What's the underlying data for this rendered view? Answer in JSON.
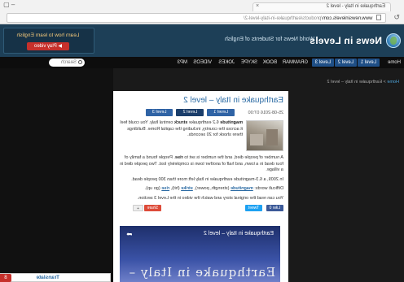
{
  "browser": {
    "tab_title": "Earthquake in Italy - level 2",
    "url_domain": "www.newsinlevels.com",
    "url_path": "/products/earthquake-in-italy-level-2/"
  },
  "header": {
    "logo": "News in Levels",
    "tagline": "World News for Students of English",
    "promo_text": "Learn how to learn English",
    "promo_button": "Play video"
  },
  "nav": {
    "items": [
      "Home",
      "Level 1",
      "Level 2",
      "Level 3",
      "GRAMMAR",
      "BOOK",
      "SKYPE",
      "JOKES",
      "VIDEOS",
      "MP3"
    ],
    "search_placeholder": "Search"
  },
  "breadcrumb": {
    "home": "Home",
    "separator": ">",
    "current": "Earthquake in Italy – level 2"
  },
  "article": {
    "title": "Earthquake in Italy – level 2",
    "date": "25-08-2016 07:00",
    "level_buttons": [
      "Level 1",
      "Level 2",
      "Level 3"
    ],
    "active_level": "Level 2",
    "p1": {
      "kw1": "magnitude",
      "t1": " 6.2 earthquake ",
      "kw2": "struck",
      "t2": " central Italy. You could feel it across the country, including the capital Rome. Buildings there shook for 20 seconds."
    },
    "p2": {
      "t1": "A number of people died, and the number is set to ",
      "kw": "rise",
      "t2": ". People found a family of four dead in a town, and half of another town is completely lost. Two people died in a village."
    },
    "p3": "In 2009, a 6.3-magnitude earthquake in Italy left more than 300 people dead.",
    "p4": {
      "label": "Difficult words: ",
      "w1": "magnitude",
      "g1": " (strength, power), ",
      "w2": "strike",
      "g2": " (hit), ",
      "w3": "rise",
      "g3": " (go up)."
    },
    "p5": "You can read the original story and watch the video in the Level 3 section.",
    "share": {
      "like": "Like",
      "count": "0",
      "tweet": "Tweet",
      "share": "Share",
      "plus": "+"
    }
  },
  "video": {
    "title": "Earthquake in Italy – level 2",
    "big_text": "Earthquake in Italy – level 2"
  },
  "sidebar": {
    "translate": "Translate",
    "badge": "8"
  },
  "colors": {
    "header_bg": "#1d3f57",
    "nav_bg": "#0d0d0d",
    "level_button": "#2f63a5",
    "link": "#2a6aa3",
    "promo_button": "#c6302b"
  }
}
